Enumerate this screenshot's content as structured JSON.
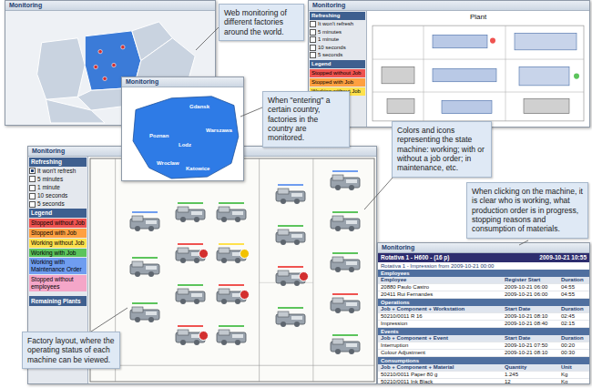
{
  "callouts": [
    {
      "text": "Web monitoring of different factories around the world."
    },
    {
      "text": "When \"entering\" a certain country, factories in the country are monitored."
    },
    {
      "text": "Colors and icons representing the state machine: working; with or without a job order; in maintenance, etc."
    },
    {
      "text": "When clicking on the machine, it is clear who is working, what production order is in progress, stopping reasons and consumption of materials."
    },
    {
      "text": "Factory layout, where the operating status of each machine can be viewed."
    }
  ],
  "world_window": {
    "title": "Monitoring",
    "countries": [
      {
        "selected": false
      },
      {
        "selected": true
      },
      {
        "selected": false
      },
      {
        "selected": false
      },
      {
        "selected": false
      },
      {
        "selected": false
      },
      {
        "selected": false
      }
    ]
  },
  "country_window": {
    "title": "Monitoring",
    "cities": [
      "Gdansk",
      "Poznan",
      "Lodz",
      "Warszawa",
      "Wroclaw",
      "Katowice"
    ]
  },
  "plant_window": {
    "title": "Monitoring",
    "refreshing": {
      "title": "Refreshing",
      "options": [
        {
          "label": "It won't refresh",
          "checked": false
        },
        {
          "label": "5 minutes",
          "checked": false
        },
        {
          "label": "1 minute",
          "checked": false
        },
        {
          "label": "10 seconds",
          "checked": false
        },
        {
          "label": "5 seconds",
          "checked": false
        }
      ]
    },
    "legend": {
      "title": "Legend",
      "items": [
        {
          "label": "Stopped without Job",
          "color": "#ef5350"
        },
        {
          "label": "Stopped with Job",
          "color": "#ffa040"
        },
        {
          "label": "Working without Job",
          "color": "#ffe14d"
        }
      ]
    },
    "plan_title": "Plant"
  },
  "main_window": {
    "title": "Monitoring",
    "refreshing": {
      "title": "Refreshing",
      "options": [
        {
          "label": "It won't refresh",
          "checked": true
        },
        {
          "label": "5 minutes",
          "checked": false
        },
        {
          "label": "1 minute",
          "checked": false
        },
        {
          "label": "10 seconds",
          "checked": false
        },
        {
          "label": "5 seconds",
          "checked": false
        }
      ]
    },
    "legend": {
      "title": "Legend",
      "items": [
        {
          "label": "Stopped without Job",
          "color": "#ef5350"
        },
        {
          "label": "Stopped with Job",
          "color": "#ffa040"
        },
        {
          "label": "Working without Job",
          "color": "#ffe14d"
        },
        {
          "label": "Working with Job",
          "color": "#5cc45c"
        },
        {
          "label": "Working with Maintenance Order",
          "color": "#6f9df0"
        },
        {
          "label": "Stopped without employees",
          "color": "#f4a6c8"
        }
      ]
    },
    "remaining": "Remaining Plants",
    "machines": [
      {
        "color": "#6f9df0",
        "kind": "none"
      },
      {
        "color": "#5cc45c",
        "kind": "none"
      },
      {
        "color": "#5cc45c",
        "kind": "none"
      },
      {
        "color": "#5cc45c",
        "kind": "none"
      },
      {
        "color": "#ef5350",
        "kind": "stop"
      },
      {
        "color": "#5cc45c",
        "kind": "none"
      },
      {
        "color": "#ef5350",
        "kind": "stop"
      },
      {
        "color": "#5cc45c",
        "kind": "none"
      },
      {
        "color": "#ffe14d",
        "kind": "warning"
      },
      {
        "color": "#ef5350",
        "kind": "stop"
      },
      {
        "color": "#5cc45c",
        "kind": "none"
      },
      {
        "color": "#6f9df0",
        "kind": "none"
      },
      {
        "color": "#5cc45c",
        "kind": "none"
      },
      {
        "color": "#ef5350",
        "kind": "stop"
      },
      {
        "color": "#5cc45c",
        "kind": "none"
      },
      {
        "color": "#6f9df0",
        "kind": "none"
      },
      {
        "color": "#5cc45c",
        "kind": "none"
      },
      {
        "color": "#5cc45c",
        "kind": "none"
      },
      {
        "color": "#ef5350",
        "kind": "none"
      },
      {
        "color": "#5cc45c",
        "kind": "none"
      }
    ]
  },
  "detail_window": {
    "title": "Monitoring",
    "machine": "Rotativa 1 - H600 - (16 p)",
    "date": "2009-10-21 10:55",
    "period": "Rotativa 1 - Impression from 2009-10-21 00:00",
    "sections": [
      {
        "title": "Employees",
        "columns": [
          "Employee",
          "Register Start",
          "Duration"
        ],
        "rows": [
          [
            "20880 Paulo Castro",
            "2009-10-21 06:00",
            "04:55"
          ],
          [
            "20411 Rui Fernandes",
            "2009-10-21 06:00",
            "04:55"
          ]
        ]
      },
      {
        "title": "Operations",
        "columns": [
          "Job + Component + Workstation",
          "Start Date",
          "Duration"
        ],
        "rows": [
          [
            "50210/0011 R 16",
            "2009-10-21 08:10",
            "02:45"
          ],
          [
            "Impression",
            "2009-10-21 08:40",
            "02:15"
          ]
        ]
      },
      {
        "title": "Events",
        "columns": [
          "Job + Component + Event",
          "Start Date",
          "Duration"
        ],
        "rows": [
          [
            "Interruption",
            "2009-10-21 07:50",
            "00:20"
          ],
          [
            "Colour Adjustment",
            "2009-10-21 08:10",
            "00:30"
          ]
        ]
      },
      {
        "title": "Consumptions",
        "columns": [
          "Job + Component + Material",
          "Quantity",
          "Unit"
        ],
        "rows": [
          [
            "50210/0011 Paper 80 g",
            "1.245",
            "Kg"
          ],
          [
            "50210/0011 Ink Black",
            "12",
            "Kg"
          ]
        ]
      }
    ]
  }
}
